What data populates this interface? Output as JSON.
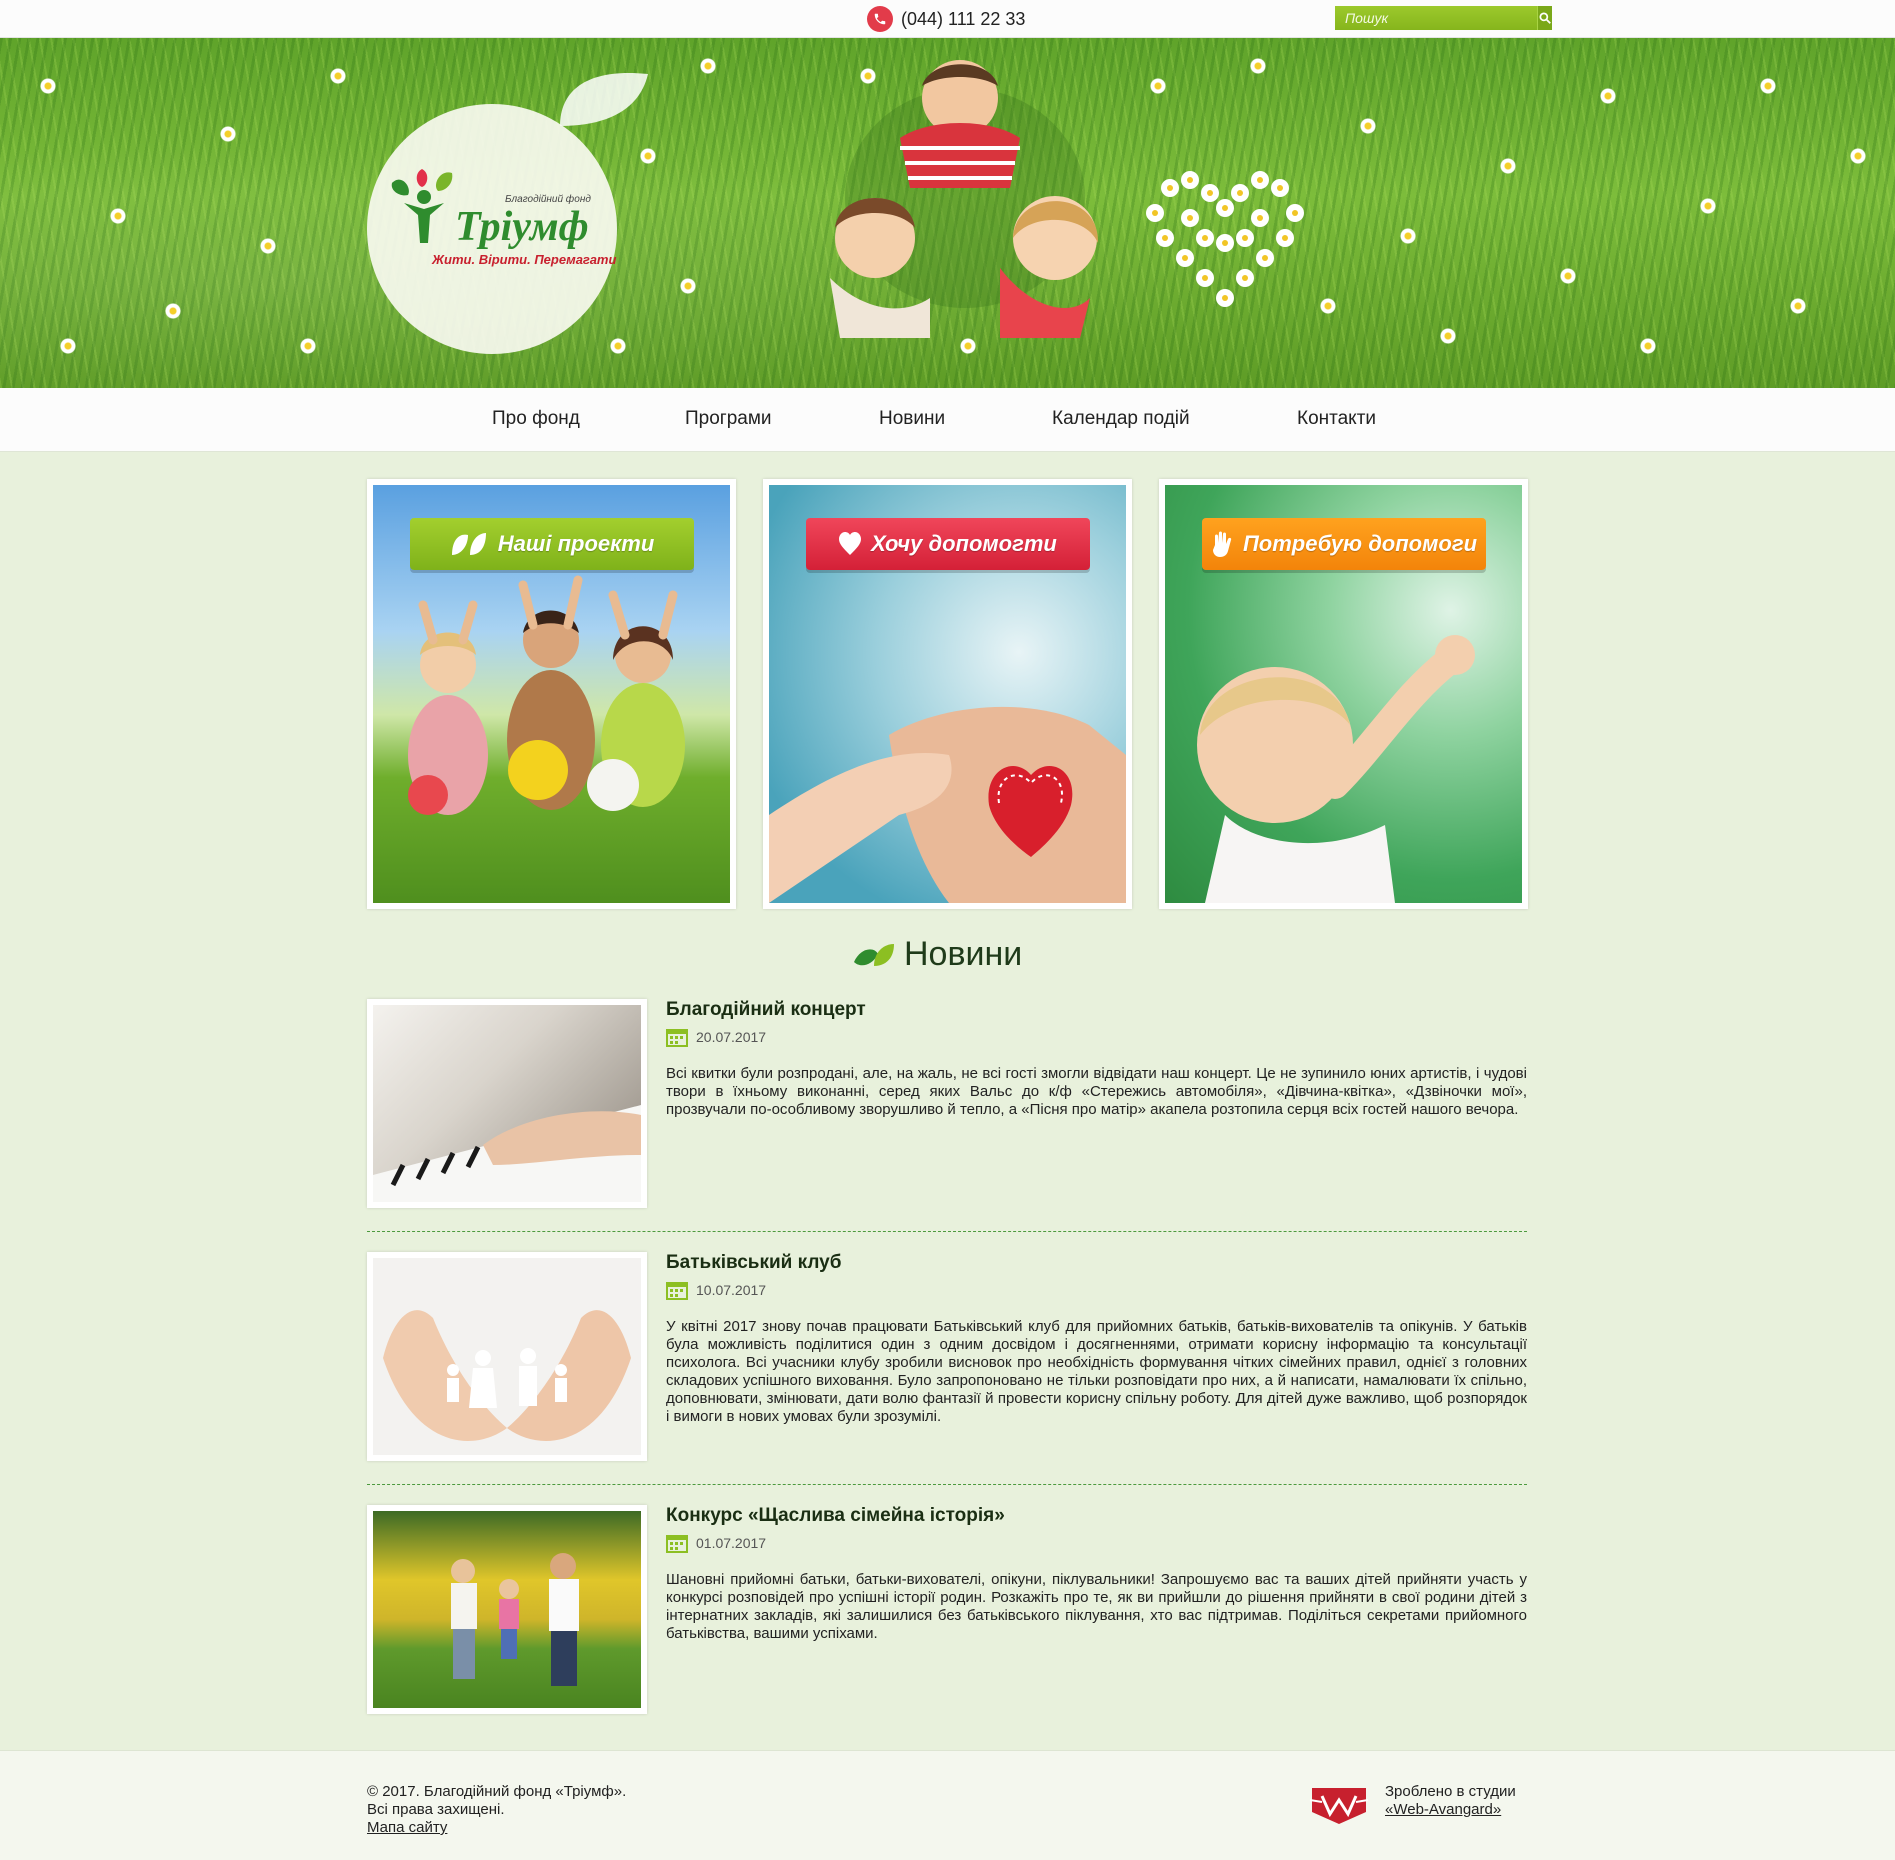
{
  "topbar": {
    "phone": "(044) 111 22 33",
    "search_placeholder": "Пошук"
  },
  "logo": {
    "subtitle": "Благодійний фонд",
    "title": "Тріумф",
    "motto": "Жити. Вірити. Перемагати"
  },
  "nav": {
    "items": [
      {
        "label": "Про фонд"
      },
      {
        "label": "Програми"
      },
      {
        "label": "Новини"
      },
      {
        "label": "Календар подій"
      },
      {
        "label": "Контакти"
      }
    ]
  },
  "cards": [
    {
      "label": "Наші проекти",
      "icon": "leaves-icon",
      "color": "#8cbf22"
    },
    {
      "label": "Хочу допомогти",
      "icon": "heart-icon",
      "color": "#e2304a"
    },
    {
      "label": "Потребую допомоги",
      "icon": "hand-icon",
      "color": "#f7900f"
    }
  ],
  "news": {
    "heading": "Новини",
    "items": [
      {
        "title": "Благодійний концерт",
        "date": "20.07.2017",
        "text": "Всі квитки були розпродані, але, на жаль, не всі гості змогли відвідати наш концерт. Це не зупинило юних артистів, і чудові твори в їхньому виконанні, серед яких Вальс до к/ф «Стережись автомобіля», «Дівчина-квітка», «Дзвіночки мої», прозвучали по-особливому зворушливо й тепло, а «Пісня про матір» акапела розтопила серця всіх гостей нашого вечора."
      },
      {
        "title": "Батьківський клуб",
        "date": "10.07.2017",
        "text": "У квітні 2017 знову почав працювати Батьківський клуб для прийомних батьків, батьків-вихователів та опікунів. У батьків була можливість поділитися один з одним досвідом і досягненнями, отримати корисну інформацію та консультації психолога. Всі учасники клубу зробили висновок про необхідність формування чітких сімейних правил, однієї з головних складових успішного виховання. Було запропоновано не тільки розповідати про них, а й написати, намалювати їх спільно, доповнювати, змінювати, дати волю фантазії й провести корисну спільну роботу. Для дітей дуже важливо, щоб розпорядок і вимоги в нових умовах були зрозумілі."
      },
      {
        "title": "Конкурс «Щаслива сімейна історія»",
        "date": "01.07.2017",
        "text": "Шановні прийомні батьки, батьки-вихователі, опікуни, піклувальники! Запрошуємо вас та ваших дітей прийняти участь у конкурсі розповідей про успішні історії родин. Розкажіть про те, як ви прийшли до рішення прийняти в свої родини дітей з інтернатних закладів, які залишилися без батьківського піклування, хто вас підтримав. Поділіться секретами прийомного батьківства, вашими успіхами."
      }
    ]
  },
  "footer": {
    "copyright_line1": "© 2017. Благодійний фонд «Тріумф».",
    "copyright_line2": "Всі права захищені.",
    "sitemap": "Мапа сайту",
    "made_by": "Зроблено в студии",
    "studio": "«Web-Avangard»"
  },
  "colors": {
    "accent_green": "#8cbf22",
    "accent_red": "#e2304a",
    "accent_orange": "#f7900f",
    "page_bg": "#e8f1dc"
  }
}
